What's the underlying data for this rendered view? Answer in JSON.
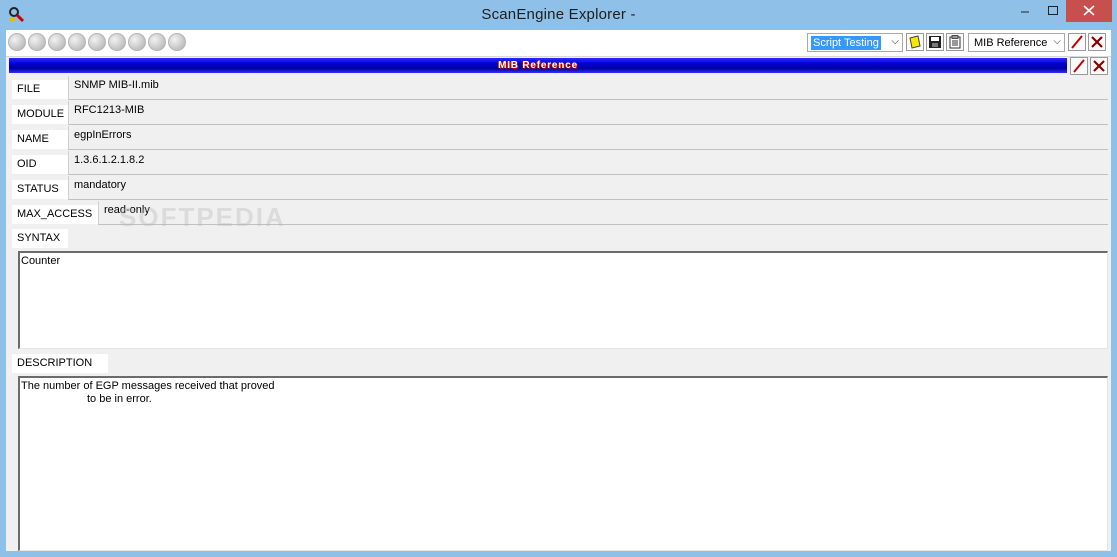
{
  "window": {
    "title": "ScanEngine Explorer -"
  },
  "toolbar": {
    "script_select": {
      "value": "Script Testing"
    },
    "mib_select": {
      "value": "MIB Reference"
    }
  },
  "panel": {
    "banner": "MIB Reference"
  },
  "fields": {
    "file": {
      "label": "FILE",
      "value": "SNMP MIB-II.mib"
    },
    "module": {
      "label": "MODULE",
      "value": "RFC1213-MIB"
    },
    "name": {
      "label": "NAME",
      "value": "egpInErrors"
    },
    "oid": {
      "label": "OID",
      "value": "1.3.6.1.2.1.8.2"
    },
    "status": {
      "label": "STATUS",
      "value": "mandatory"
    },
    "max_access": {
      "label": "MAX_ACCESS",
      "value": "read-only"
    }
  },
  "syntax": {
    "label": "SYNTAX",
    "value": "Counter"
  },
  "description": {
    "label": "DESCRIPTION",
    "line1": "The number of EGP messages received that proved",
    "line2": "to be in error."
  },
  "watermark": "SOFTPEDIA",
  "colors": {
    "title_bar": "#8fc1e8",
    "close_button": "#c7504f",
    "banner_blue": "#0000cc",
    "selection": "#3399ff"
  }
}
